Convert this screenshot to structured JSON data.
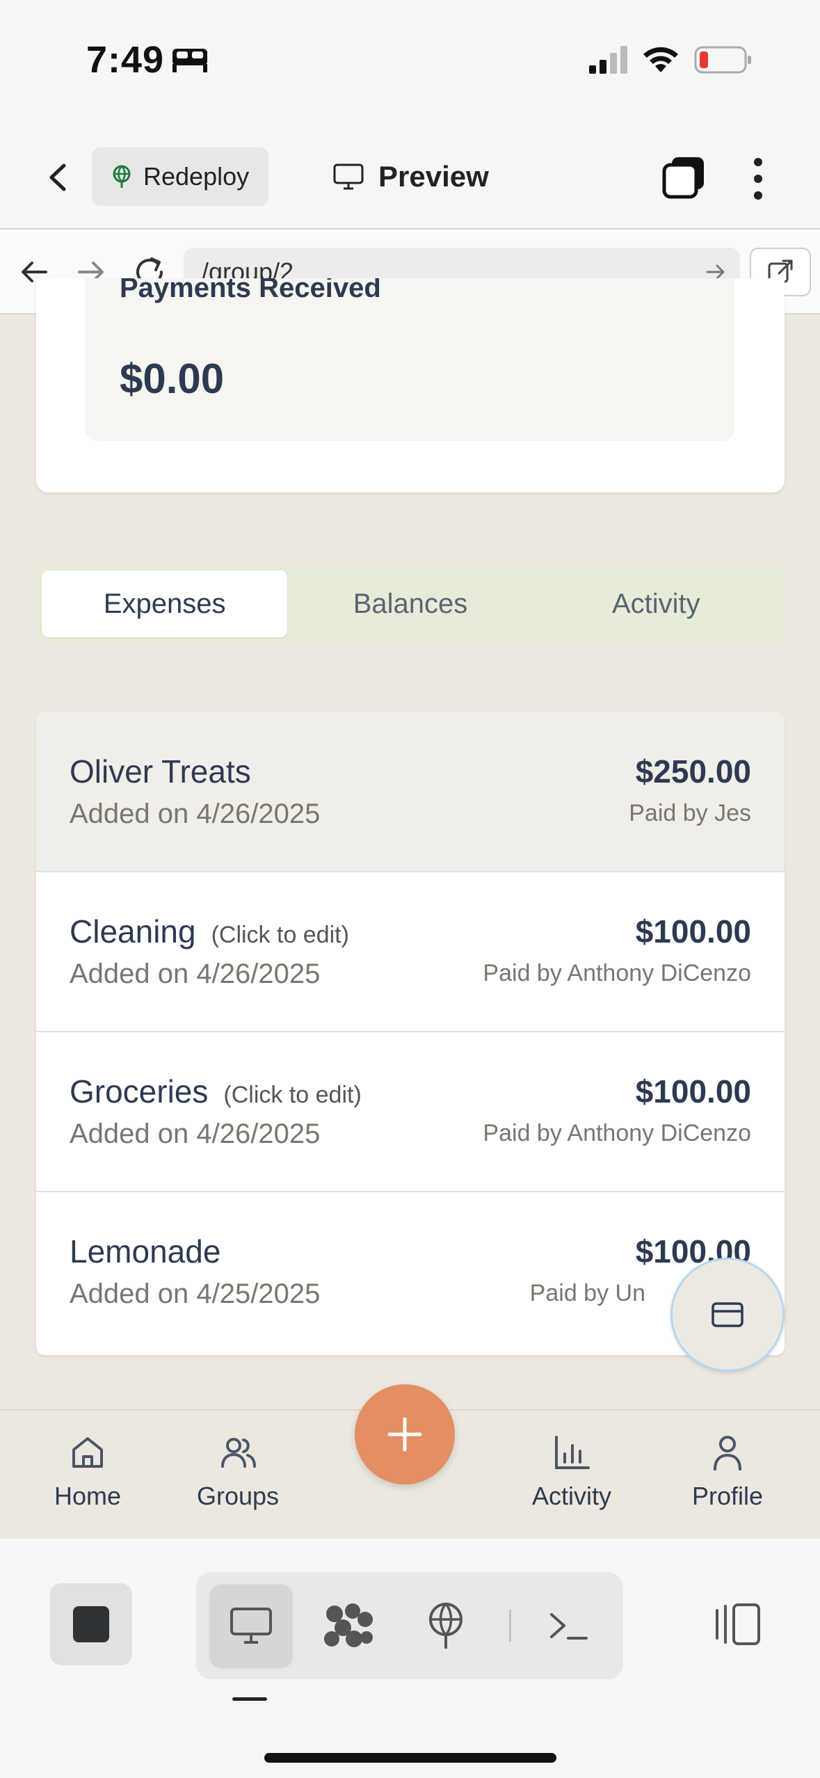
{
  "status_bar": {
    "time": "7:49"
  },
  "toolbar": {
    "redeploy_label": "Redeploy",
    "preview_label": "Preview"
  },
  "browser": {
    "url": "/group/2"
  },
  "summary": {
    "label": "Payments Received",
    "value": "$0.00"
  },
  "tabs": [
    {
      "label": "Expenses",
      "active": true
    },
    {
      "label": "Balances",
      "active": false
    },
    {
      "label": "Activity",
      "active": false
    }
  ],
  "expenses": [
    {
      "name": "Oliver Treats",
      "hint": "",
      "date": "Added on 4/26/2025",
      "amount": "$250.00",
      "paid_by": "Paid by Jes"
    },
    {
      "name": "Cleaning",
      "hint": "(Click to edit)",
      "date": "Added on 4/26/2025",
      "amount": "$100.00",
      "paid_by": "Paid by Anthony DiCenzo"
    },
    {
      "name": "Groceries",
      "hint": "(Click to edit)",
      "date": "Added on 4/26/2025",
      "amount": "$100.00",
      "paid_by": "Paid by Anthony DiCenzo"
    },
    {
      "name": "Lemonade",
      "hint": "",
      "date": "Added on 4/25/2025",
      "amount": "$100.00",
      "paid_by": "Paid by Un"
    }
  ],
  "app_nav": {
    "home": "Home",
    "groups": "Groups",
    "activity": "Activity",
    "profile": "Profile"
  },
  "colors": {
    "accent": "#e48e64",
    "text": "#2d3a52",
    "background": "#ece8df",
    "tabs_bg": "#e6ecd8"
  },
  "icons": [
    "bed-icon",
    "signal-icon",
    "wifi-icon",
    "battery-icon",
    "back-chevron-icon",
    "globe-icon",
    "monitor-icon",
    "windows-icon",
    "kebab-icon",
    "arrow-left-icon",
    "arrow-right-icon",
    "reload-icon",
    "external-link-icon",
    "credit-card-icon",
    "home-icon",
    "users-icon",
    "plus-icon",
    "bar-chart-icon",
    "user-icon",
    "stop-icon",
    "layout-icon",
    "terminal-icon",
    "panel-icon"
  ]
}
